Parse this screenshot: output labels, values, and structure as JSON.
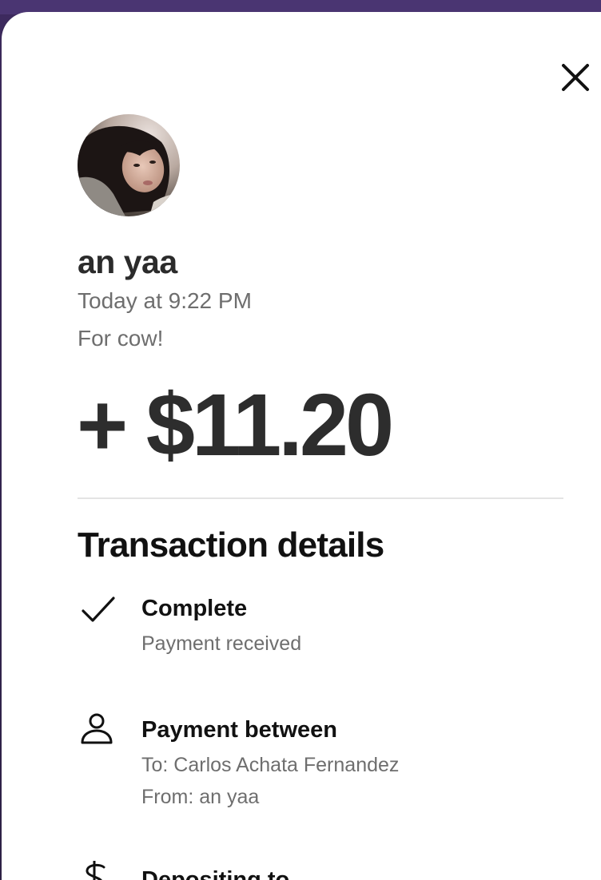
{
  "header": {
    "close_icon": "close-icon"
  },
  "profile": {
    "avatar": "avatar-photo",
    "name": "an yaa",
    "time": "Today at 9:22 PM",
    "note": "For cow!"
  },
  "amount": "+ $11.20",
  "transaction_details": {
    "title": "Transaction details",
    "items": [
      {
        "icon": "check-icon",
        "title": "Complete",
        "lines": [
          "Payment received"
        ]
      },
      {
        "icon": "person-icon",
        "title": "Payment between",
        "lines": [
          "To: Carlos Achata Fernandez",
          "From: an yaa"
        ]
      },
      {
        "icon": "dollar-icon",
        "title": "Depositing to",
        "lines": []
      }
    ]
  }
}
